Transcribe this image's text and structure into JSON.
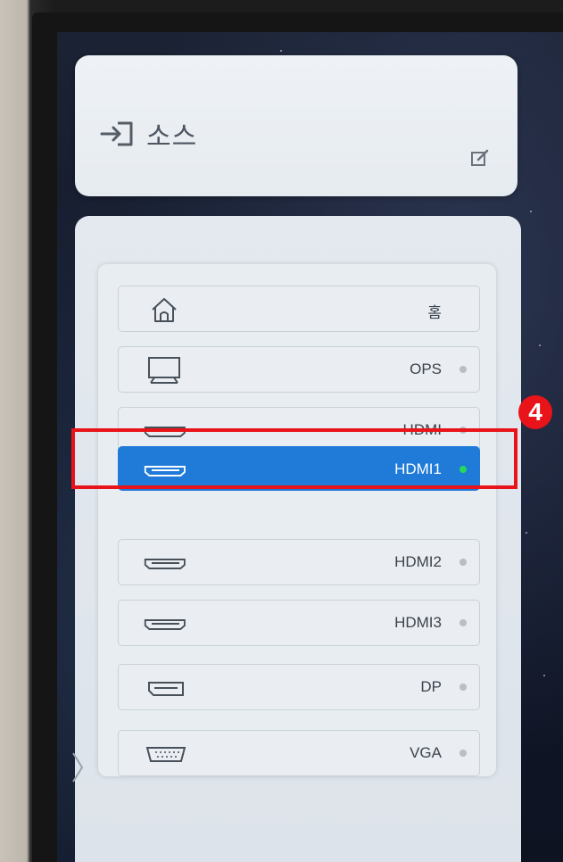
{
  "header": {
    "title": "소스",
    "icon": "input-source-icon",
    "edit_icon": "edit-icon"
  },
  "sources": [
    {
      "label": "홈",
      "icon": "home-icon",
      "status_dot": false
    },
    {
      "label": "OPS",
      "icon": "monitor-icon",
      "status_dot": true
    },
    {
      "label": "HDMI",
      "icon": "hdmi-port-icon",
      "status_dot": true
    },
    {
      "label": "HDMI1",
      "icon": "hdmi-port-icon",
      "status_dot": true,
      "selected": true
    },
    {
      "label": "HDMI2",
      "icon": "hdmi-port-icon",
      "status_dot": true
    },
    {
      "label": "HDMI3",
      "icon": "hdmi-port-icon",
      "status_dot": true
    },
    {
      "label": "DP",
      "icon": "displayport-icon",
      "status_dot": true
    },
    {
      "label": "VGA",
      "icon": "vga-port-icon",
      "status_dot": true
    }
  ],
  "annotation": {
    "step_number": "4",
    "highlight_color": "#e8141a"
  },
  "colors": {
    "selected_bg": "#1f7ad8",
    "active_dot": "#26d95a",
    "inactive_dot": "#b8bec6"
  }
}
